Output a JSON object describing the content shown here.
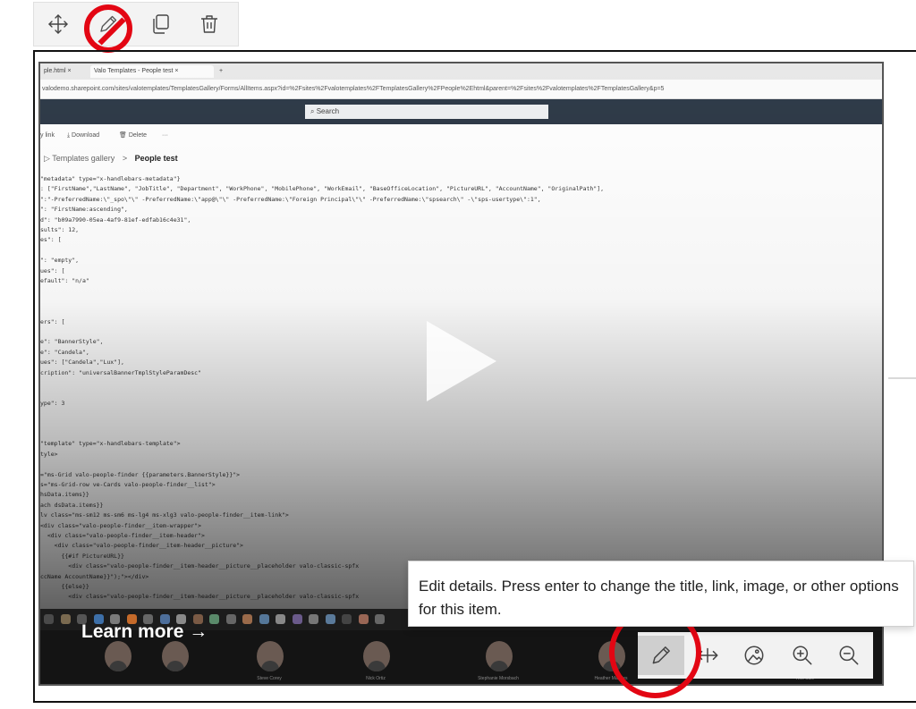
{
  "toolbar": {
    "items": [
      {
        "name": "move-icon"
      },
      {
        "name": "edit-icon"
      },
      {
        "name": "duplicate-icon"
      },
      {
        "name": "delete-icon"
      }
    ]
  },
  "video": {
    "browser": {
      "tabs": [
        "ple.html",
        "Valo Templates - People test"
      ],
      "url": "valodemo.sharepoint.com/sites/valotemplates/TemplatesGallery/Forms/AllItems.aspx?id=%2Fsites%2Fvalotemplates%2FTemplatesGallery%2FPeople%2Ehtml&parent=%2Fsites%2Fvalotemplates%2FTemplatesGallery&p=5",
      "search_label": "Search"
    },
    "commands": [
      "y link",
      "Download",
      "Delete",
      "···"
    ],
    "breadcrumb": {
      "parent": "Templates gallery",
      "separator": ">",
      "current": "People test"
    },
    "code_lines": [
      "\"metadata\" type=\"x-handlebars-metadata\"}",
      ": [\"FirstName\",\"LastName\", \"JobTitle\", \"Department\", \"WorkPhone\", \"MobilePhone\", \"WorkEmail\", \"BaseOfficeLocation\", \"PictureURL\", \"AccountName\", \"OriginalPath\"],",
      "\":\"-PreferredName:\\\"_spo\\\"\\\" -PreferredName:\\\"app@\\\"\\\" -PreferredName:\\\"Foreign Principal\\\"\\\" -PreferredName:\\\"spsearch\\\" -\\\"sps-usertype\\\":1\",",
      "\": \"FirstName:ascending\",",
      "d\": \"b09a7990-05ea-4af9-81ef-edfab16c4e31\",",
      "sults\": 12,",
      "es\": [",
      "",
      "\": \"empty\",",
      "ues\": [",
      "efault\": \"n/a\"",
      "",
      "",
      "",
      "ers\": [",
      "",
      "e\": \"BannerStyle\",",
      "e\": \"Candela\",",
      "ues\": [\"Candela\",\"Lux\"],",
      "cription\": \"universalBannerTmplStyleParamDesc\"",
      "",
      "",
      "ype\": 3",
      "",
      "",
      "",
      "\"template\" type=\"x-handlebars-template\">",
      "tyle>",
      "",
      "=\"ms-Grid valo-people-finder {{parameters.BannerStyle}}\">",
      "s=\"ms-Grid-row ve-Cards valo-people-finder__list\">",
      "hsData.items}}",
      "ach dsData.items}}",
      "lv class=\"ms-sm12 ms-sm6 ms-lg4 ms-xlg3 valo-people-finder__item-link\">",
      "<div class=\"valo-people-finder__item-wrapper\">",
      "  <div class=\"valo-people-finder__item-header\">",
      "    <div class=\"valo-people-finder__item-header__picture\">",
      "      {{#if PictureURL}}",
      "        <div class=\"valo-people-finder__item-header__picture__placeholder valo-classic-spfx",
      "ccName AccountName}}\");\"></div>",
      "      {{else}}",
      "        <div class=\"valo-people-finder__item-header__picture__placeholder valo-classic-spfx"
    ],
    "learn_more": "Learn more →",
    "participants": [
      {
        "name": ""
      },
      {
        "name": ""
      },
      {
        "name": "Steve Corey"
      },
      {
        "name": "Nick Ortiz"
      },
      {
        "name": "Stephanie Morsbach"
      },
      {
        "name": "Heather Marples"
      },
      {
        "name": ""
      },
      {
        "name": "Rob Sale"
      }
    ],
    "tools": [
      {
        "name": "edit-details-icon",
        "selected": true
      },
      {
        "name": "resize-horizontal-icon",
        "selected": false
      },
      {
        "name": "image-focus-icon",
        "selected": false
      },
      {
        "name": "zoom-in-icon",
        "selected": false
      },
      {
        "name": "zoom-out-icon",
        "selected": false
      }
    ]
  },
  "tooltip": {
    "text": "Edit details. Press enter to change the title, link, image, or other options for this item."
  },
  "colors": {
    "annotation_red": "#e30613",
    "toolbar_bg": "#f3f3f3",
    "sp_header": "#2f3b49",
    "selected_tool": "#cfcfcf"
  }
}
